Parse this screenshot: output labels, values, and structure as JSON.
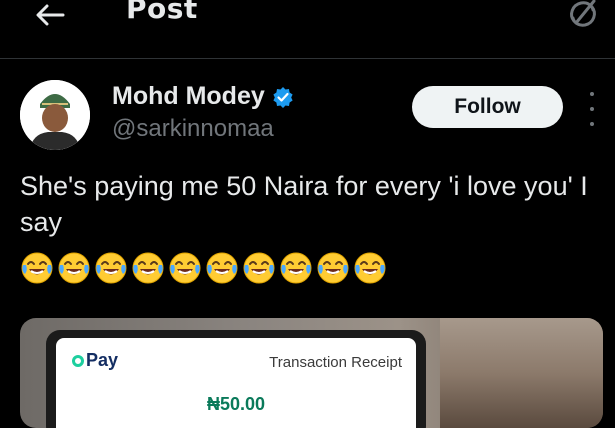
{
  "header": {
    "title": "Post",
    "back_icon": "arrow-left-icon",
    "grok_icon": "grok-icon"
  },
  "post": {
    "author_name": "Mohd Modey",
    "author_handle": "@sarkinnomaa",
    "verified_icon": "verified-badge-icon",
    "follow_label": "Follow",
    "more_icon": "more-vertical-icon",
    "text": "She's paying me 50 Naira for every 'i love you' I say",
    "emoji_name": "face-with-tears-of-joy-emoji",
    "emoji_count": 10
  },
  "media": {
    "logo_o": "O",
    "logo_pay": "Pay",
    "receipt_title": "Transaction Receipt",
    "amount": "₦50.00"
  },
  "colors": {
    "background": "#000000",
    "text_primary": "#e7e9ea",
    "text_secondary": "#71767b",
    "verified_blue": "#1d9bf0",
    "follow_bg": "#eff3f4",
    "opay_green": "#1dcf9f",
    "amount_green": "#0a7a5a"
  }
}
